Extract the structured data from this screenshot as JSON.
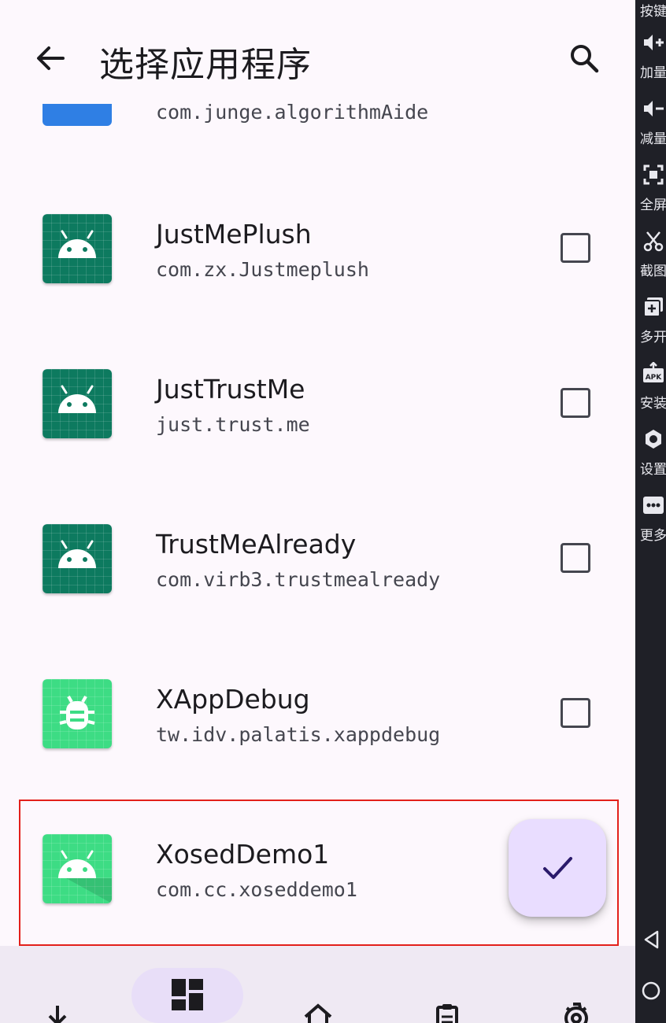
{
  "header": {
    "title": "选择应用程序",
    "back_icon": "arrow-back-icon",
    "search_icon": "search-icon"
  },
  "list": {
    "partial_item": {
      "package": "com.junge.algorithmAide"
    },
    "items": [
      {
        "name": "JustMePlush",
        "package": "com.zx.Justmeplush",
        "icon": "android-icon",
        "checked": false
      },
      {
        "name": "JustTrustMe",
        "package": "just.trust.me",
        "icon": "android-icon",
        "checked": false
      },
      {
        "name": "TrustMeAlready",
        "package": "com.virb3.trustmealready",
        "icon": "android-icon",
        "checked": false
      },
      {
        "name": "XAppDebug",
        "package": "tw.idv.palatis.xappdebug",
        "icon": "bug-icon",
        "checked": false
      },
      {
        "name": "XosedDemo1",
        "package": "com.cc.xoseddemo1",
        "icon": "android-icon",
        "checked": false
      }
    ]
  },
  "fab": {
    "icon": "check-icon"
  },
  "bottom_nav": [
    {
      "icon": "download-icon",
      "selected": false
    },
    {
      "icon": "dashboard-icon",
      "selected": true
    },
    {
      "icon": "home-icon",
      "selected": false
    },
    {
      "icon": "clipboard-icon",
      "selected": false
    },
    {
      "icon": "settings-icon",
      "selected": false
    }
  ],
  "emulator_toolbar": {
    "tools": [
      {
        "label": "按键",
        "icon": "keys-icon"
      },
      {
        "label": "加量",
        "icon": "volume-up-icon"
      },
      {
        "label": "减量",
        "icon": "volume-down-icon"
      },
      {
        "label": "全屏",
        "icon": "fullscreen-icon"
      },
      {
        "label": "截图",
        "icon": "scissors-icon"
      },
      {
        "label": "多开",
        "icon": "multi-instance-icon"
      },
      {
        "label": "安装",
        "icon": "apk-icon"
      },
      {
        "label": "设置",
        "icon": "gear-icon"
      },
      {
        "label": "更多",
        "icon": "more-icon"
      }
    ],
    "nav": [
      {
        "icon": "back-triangle-icon"
      },
      {
        "icon": "home-circle-icon"
      }
    ]
  },
  "colors": {
    "background": "#fdf8fd",
    "icon_dark_green": "#0d7a5f",
    "icon_light_green": "#3ddc84",
    "fab_bg": "#e9ddff",
    "check_color": "#2a1a6b",
    "highlight_border": "#e3201b",
    "side_panel": "#1f2027"
  }
}
